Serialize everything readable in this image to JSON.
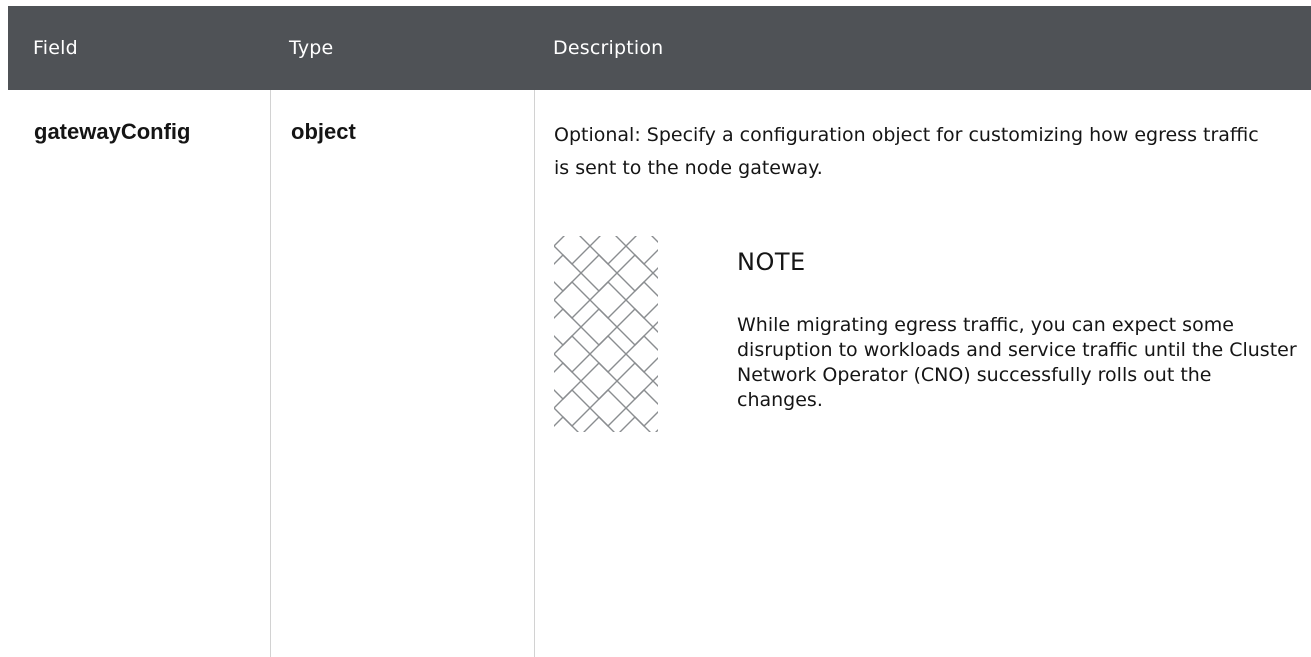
{
  "table": {
    "headers": {
      "field": "Field",
      "type": "Type",
      "description": "Description"
    },
    "rows": [
      {
        "field": "gatewayConfig",
        "type": "object",
        "description": "Optional: Specify a configuration object for customizing how egress traffic is sent to the node gateway.",
        "note": {
          "icon": "note-pattern-icon",
          "title": "NOTE",
          "body": "While migrating egress traffic, you can expect some disruption to workloads and service traffic until the Cluster Network Operator (CNO) successfully rolls out the changes."
        }
      }
    ]
  },
  "colors": {
    "header_background": "#4f5256",
    "header_text": "#ffffff",
    "divider": "#d2d2d2",
    "icon_stroke": "#8a8d90"
  }
}
